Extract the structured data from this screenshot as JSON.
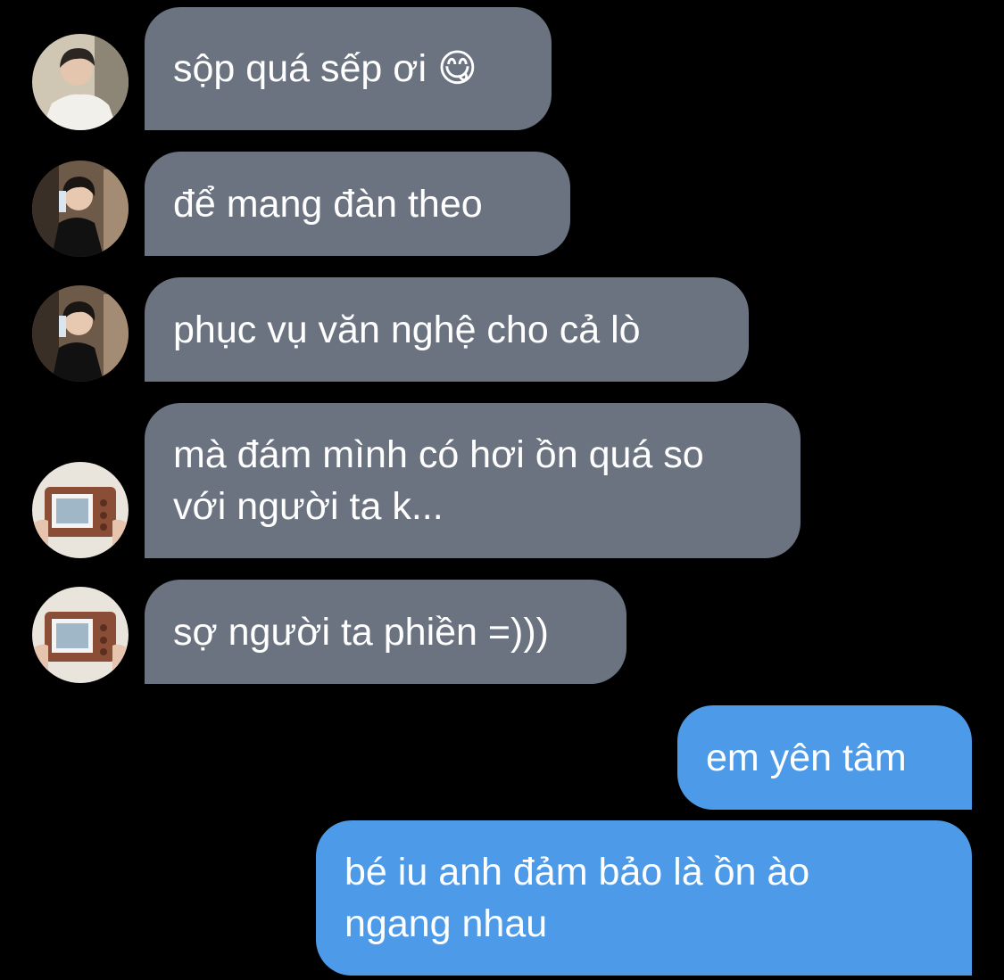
{
  "messages": [
    {
      "direction": "incoming",
      "avatar": "avatar-boy-white-shirt",
      "text": "sộp quá sếp ơi 😋"
    },
    {
      "direction": "incoming",
      "avatar": "avatar-boy-black-shirt",
      "text": "để mang đàn theo"
    },
    {
      "direction": "incoming",
      "avatar": "avatar-boy-black-shirt",
      "text": "phục vụ văn nghệ cho cả lò"
    },
    {
      "direction": "incoming",
      "avatar": "avatar-retro-camera",
      "text": "mà đám mình có hơi ồn quá so\nvới người ta k..."
    },
    {
      "direction": "incoming",
      "avatar": "avatar-retro-camera",
      "text": "sợ người ta phiền =)))"
    },
    {
      "direction": "outgoing",
      "text": "em yên tâm"
    },
    {
      "direction": "outgoing",
      "text": "bé iu anh đảm bảo là ồn ào\nngang nhau"
    }
  ],
  "colors": {
    "background": "#000000",
    "incoming_bubble": "#6b7380",
    "outgoing_bubble": "#4d9ae8",
    "text": "#ffffff"
  }
}
